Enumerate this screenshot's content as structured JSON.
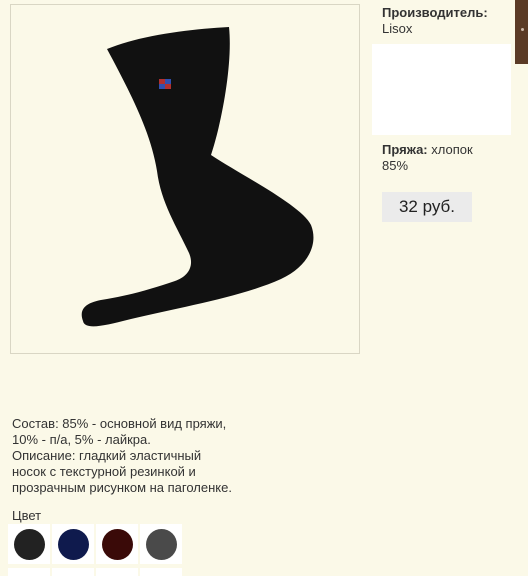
{
  "product": {
    "image_alt": "Носки черные",
    "manufacturer_label": "Производитель:",
    "manufacturer_value": "Lisox",
    "yarn_label": "Пряжа:",
    "yarn_value": "хлопок 85%",
    "price": "32 руб."
  },
  "description": {
    "lines": [
      "Состав: 85% - основной вид пряжи,",
      "10% - п/а, 5% - лайкра.",
      "Описание: гладкий эластичный",
      "носок с текстурной резинкой и",
      "прозрачным рисунком на паголенке."
    ]
  },
  "colors": {
    "title": "Цвет",
    "swatches": [
      {
        "name": "black",
        "hex": "#222222"
      },
      {
        "name": "navy",
        "hex": "#0f1a4d"
      },
      {
        "name": "burgundy",
        "hex": "#3a0a08"
      },
      {
        "name": "grey",
        "hex": "#4a4a4a"
      }
    ]
  }
}
